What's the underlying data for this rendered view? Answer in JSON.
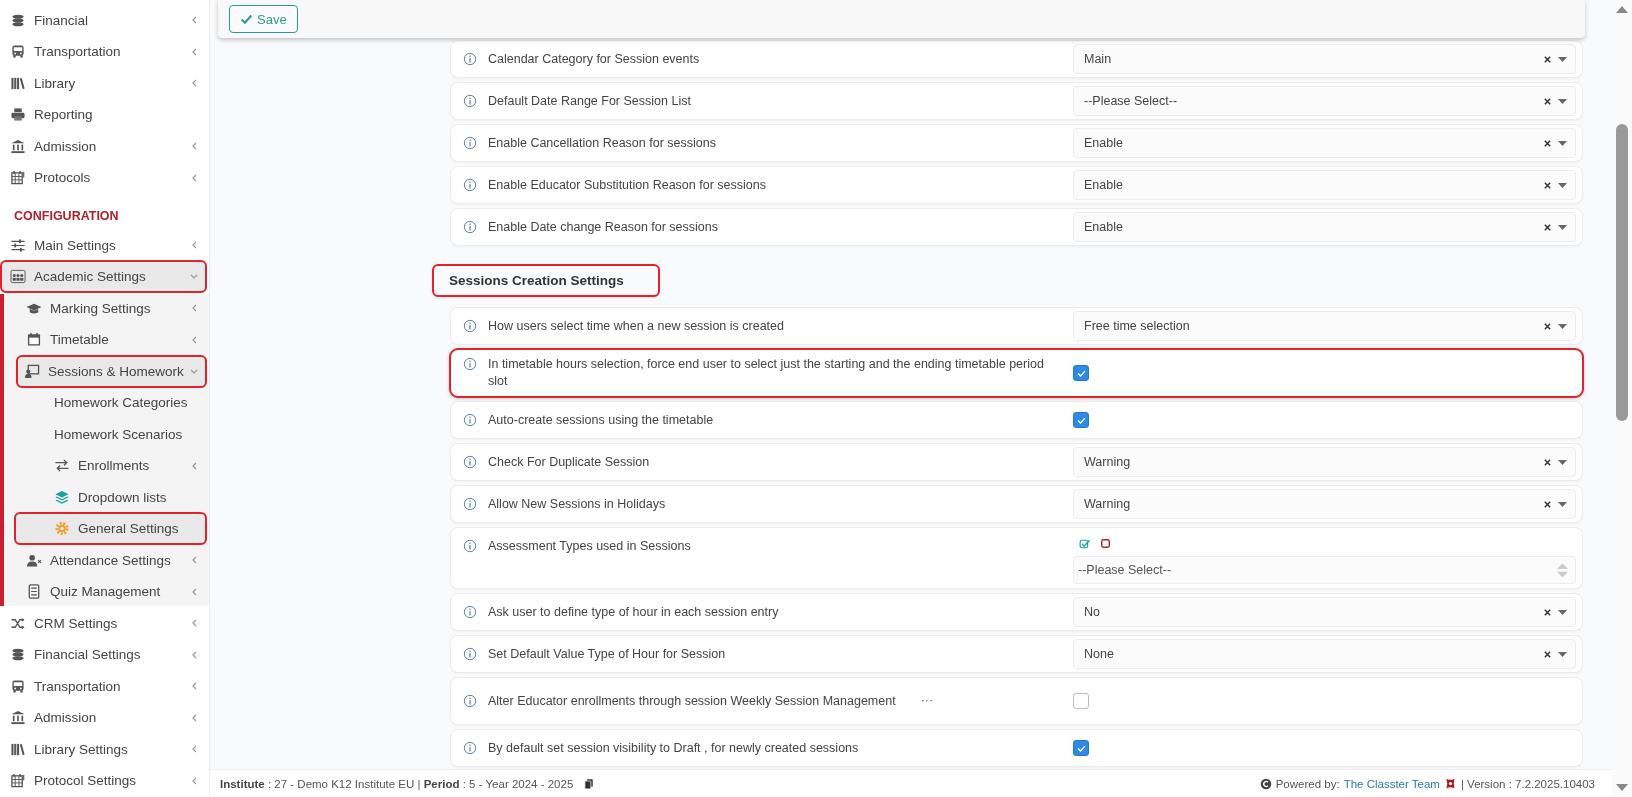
{
  "save_button": {
    "label": "Save"
  },
  "sidebar": {
    "sections": [
      {
        "items": [
          {
            "label": "Financial",
            "expandable": true,
            "selected": false,
            "highlighted": false
          },
          {
            "label": "Transportation",
            "expandable": true,
            "selected": false,
            "highlighted": false
          },
          {
            "label": "Library",
            "expandable": true,
            "selected": false,
            "highlighted": false
          },
          {
            "label": "Reporting",
            "expandable": false,
            "selected": false,
            "highlighted": false
          },
          {
            "label": "Admission",
            "expandable": true,
            "selected": false,
            "highlighted": false
          },
          {
            "label": "Protocols",
            "expandable": true,
            "selected": false,
            "highlighted": false
          }
        ]
      },
      {
        "title": "CONFIGURATION",
        "items": [
          {
            "label": "Main Settings",
            "expandable": true,
            "selected": false,
            "highlighted": false
          },
          {
            "label": "Academic Settings",
            "expandable": true,
            "expanded": true,
            "selected": true,
            "highlighted": true,
            "children": [
              {
                "label": "Marking Settings",
                "expandable": true,
                "selected": false,
                "highlighted": false
              },
              {
                "label": "Timetable",
                "expandable": true,
                "selected": false,
                "highlighted": false
              },
              {
                "label": "Sessions & Homework",
                "expandable": true,
                "expanded": true,
                "selected": true,
                "highlighted": true,
                "children": [
                  {
                    "label": "Homework Categories",
                    "expandable": false,
                    "selected": false,
                    "highlighted": false
                  },
                  {
                    "label": "Homework Scenarios",
                    "expandable": false,
                    "selected": false,
                    "highlighted": false
                  },
                  {
                    "label": "Enrollments",
                    "expandable": true,
                    "selected": false,
                    "highlighted": false
                  },
                  {
                    "label": "Dropdown lists",
                    "expandable": false,
                    "selected": false,
                    "highlighted": false
                  },
                  {
                    "label": "General Settings",
                    "expandable": false,
                    "selected": true,
                    "highlighted": true
                  }
                ]
              },
              {
                "label": "Attendance Settings",
                "expandable": true,
                "selected": false,
                "highlighted": false
              },
              {
                "label": "Quiz Management",
                "expandable": true,
                "selected": false,
                "highlighted": false
              }
            ]
          },
          {
            "label": "CRM Settings",
            "expandable": true,
            "selected": false,
            "highlighted": false
          },
          {
            "label": "Financial Settings",
            "expandable": true,
            "selected": false,
            "highlighted": false
          },
          {
            "label": "Transportation",
            "expandable": true,
            "selected": false,
            "highlighted": false
          },
          {
            "label": "Admission",
            "expandable": true,
            "selected": false,
            "highlighted": false
          },
          {
            "label": "Library Settings",
            "expandable": true,
            "selected": false,
            "highlighted": false
          },
          {
            "label": "Protocol Settings",
            "expandable": true,
            "selected": false,
            "highlighted": false
          }
        ]
      }
    ]
  },
  "settings": {
    "sections": [
      {
        "rows": [
          {
            "kind": "select",
            "label": "Calendar Category for Session events",
            "value": "Main",
            "highlighted": false
          },
          {
            "kind": "select",
            "label": "Default Date Range For Session List",
            "value": "--Please Select--",
            "highlighted": false
          },
          {
            "kind": "select",
            "label": "Enable Cancellation Reason for sessions",
            "value": "Enable",
            "highlighted": false
          },
          {
            "kind": "select",
            "label": "Enable Educator Substitution Reason for sessions",
            "value": "Enable",
            "highlighted": false
          },
          {
            "kind": "select",
            "label": "Enable Date change Reason for sessions",
            "value": "Enable",
            "highlighted": false
          }
        ]
      },
      {
        "title": "Sessions Creation Settings",
        "highlighted": true,
        "rows": [
          {
            "kind": "select",
            "label": "How users select time when a new session is created",
            "value": "Free time selection",
            "highlighted": false
          },
          {
            "kind": "checkbox",
            "label": "In timetable hours selection, force end user to select just the starting and the ending timetable period slot",
            "checked": true,
            "highlighted": true
          },
          {
            "kind": "checkbox",
            "label": "Auto-create sessions using the timetable",
            "checked": true,
            "highlighted": false
          },
          {
            "kind": "select",
            "label": "Check For Duplicate Session",
            "value": "Warning",
            "highlighted": false
          },
          {
            "kind": "select",
            "label": "Allow New Sessions in Holidays",
            "value": "Warning",
            "highlighted": false
          },
          {
            "kind": "multiselect",
            "label": "Assessment Types used in Sessions",
            "placeholder": "--Please Select--",
            "highlighted": false
          },
          {
            "kind": "select",
            "label": "Ask user to define type of hour in each session entry",
            "value": "No",
            "highlighted": false
          },
          {
            "kind": "select",
            "label": "Set Default Value Type of Hour for Session",
            "value": "None",
            "highlighted": false
          },
          {
            "kind": "checkbox",
            "label": "Alter Educator enrollments through session Weekly Session Management",
            "more": "···",
            "checked": false,
            "highlighted": false
          },
          {
            "kind": "checkbox",
            "label": "By default set session visibility to Draft , for newly created sessions",
            "checked": true,
            "highlighted": false
          }
        ]
      }
    ]
  },
  "footer": {
    "info": "**Institute** : 27 - Demo K12 Institute EU | **Period** : 5 - Year 2024 - 2025",
    "powered_by": "Powered by:",
    "team_link": "The Classter Team",
    "version": "| Version : 7.2.2025.10403"
  }
}
